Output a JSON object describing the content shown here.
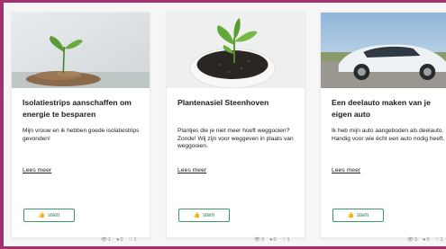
{
  "cards": [
    {
      "title": "Isolatiestrips aanschaffen om energie te besparen",
      "description": "Mijn vrouw en ik hebben goede isolatiestrips gevonden!",
      "read_more": "Lees meer",
      "vote_label": "stem",
      "vote_icon": "thumbs-up-icon",
      "views": "1",
      "comments": "0",
      "likes": "1"
    },
    {
      "title": "Plantenasiel Steenhoven",
      "description": "Plantjes die je niet meer hoeft weggooien? Zonde! Wij zijn voor weggeven in plaats van weggooien.",
      "read_more": "Lees meer",
      "vote_label": "stem",
      "vote_icon": "thumbs-up-icon",
      "views": "3",
      "comments": "0",
      "likes": "1"
    },
    {
      "title": "Een deelauto maken van je eigen auto",
      "description": "Ik heb mijn auto aangeboden als deelauto. Handig voor wie écht een auto nodig heeft.",
      "read_more": "Lees meer",
      "vote_label": "stem",
      "vote_icon": "thumbs-up-icon",
      "views": "3",
      "comments": "0",
      "likes": "1"
    }
  ],
  "colors": {
    "frame": "#a0306e",
    "vote_border": "#3b9a64",
    "vote_text": "#2f7c50"
  },
  "icons": {
    "views": "eye-icon",
    "comments": "comment-icon",
    "likes": "heart-icon"
  }
}
